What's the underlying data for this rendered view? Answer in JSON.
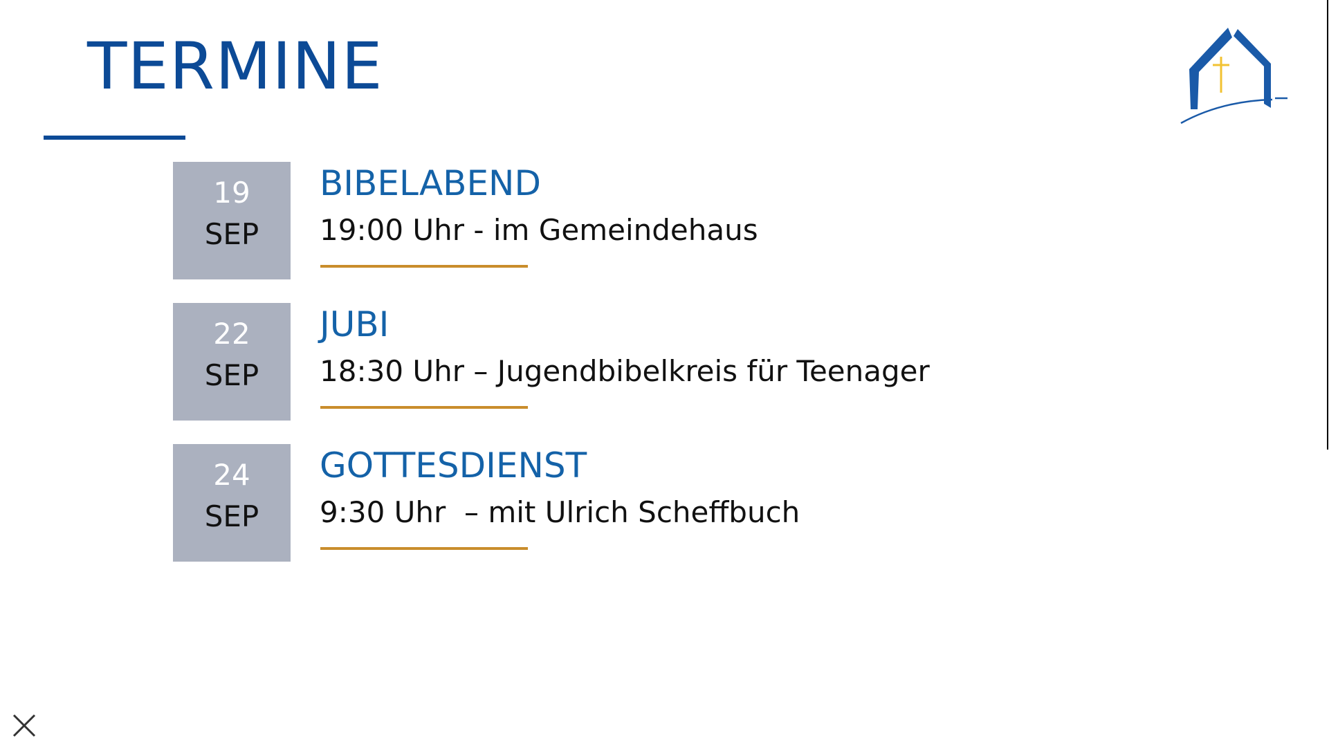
{
  "slide": {
    "title": "TERMINE"
  },
  "events": [
    {
      "day": "19",
      "month": "SEP",
      "title": "BIBELABEND",
      "detail": "19:00 Uhr - im Gemeindehaus"
    },
    {
      "day": "22",
      "month": "SEP",
      "title": "JUBI",
      "detail": "18:30 Uhr – Jugendbibelkreis für Teenager"
    },
    {
      "day": "24",
      "month": "SEP",
      "title": "GOTTESDIENST",
      "detail": "9:30 Uhr  – mit Ulrich Scheffbuch"
    }
  ],
  "icons": {
    "logo": "church-logo-icon",
    "close": "close-icon"
  },
  "colors": {
    "title_blue": "#0c4a96",
    "event_title_blue": "#1462a8",
    "date_box_gray": "#abb1bf",
    "accent_gold": "#c98d2c",
    "logo_cross_yellow": "#f2c232"
  }
}
